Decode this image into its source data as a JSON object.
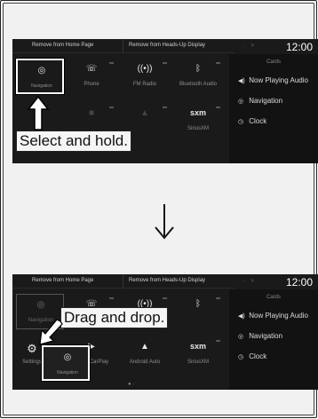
{
  "screen1": {
    "topbar": {
      "left": "Remove from Home Page",
      "right": "Remove from Heads-Up Display"
    },
    "time": "12:00",
    "cards_title": "Cards",
    "cards": [
      {
        "icon": "speaker-icon",
        "label": "Now Playing Audio"
      },
      {
        "icon": "navigation-icon",
        "label": "Navigation"
      },
      {
        "icon": "clock-icon",
        "label": "Clock"
      }
    ],
    "tiles": [
      "Navigation",
      "Phone",
      "FM Radio",
      "Bluetooth Audio",
      "",
      "",
      "SiriusXM"
    ],
    "sxm_logo": "sxm",
    "callout": "Select and hold."
  },
  "screen2": {
    "topbar": {
      "left": "Remove from Home Page",
      "right": "Remove from Heads-Up Display"
    },
    "time": "12:00",
    "cards_title": "Cards",
    "cards": [
      {
        "icon": "speaker-icon",
        "label": "Now Playing Audio"
      },
      {
        "icon": "navigation-icon",
        "label": "Navigation"
      },
      {
        "icon": "clock-icon",
        "label": "Clock"
      }
    ],
    "tiles": [
      "Navigation",
      "Settings",
      "Apple CarPlay",
      "Android Auto",
      "SiriusXM"
    ],
    "sxm_logo": "sxm",
    "dragged_tile": "Navigation",
    "callout": "Drag and drop."
  }
}
